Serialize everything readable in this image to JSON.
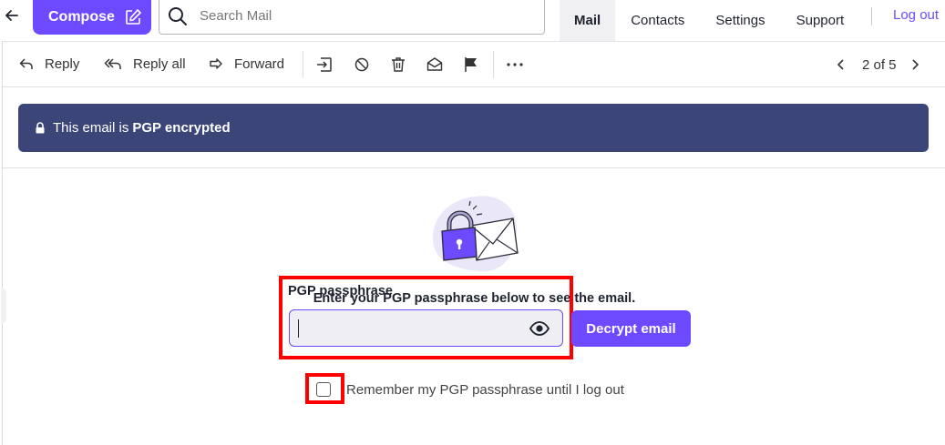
{
  "topbar": {
    "compose_label": "Compose",
    "search_placeholder": "Search Mail",
    "nav": [
      "Mail",
      "Contacts",
      "Settings",
      "Support"
    ],
    "active_nav": "Mail",
    "logout_label": "Log out"
  },
  "toolbar": {
    "reply_label": "Reply",
    "reply_all_label": "Reply all",
    "forward_label": "Forward",
    "icons": [
      "move-to-folder-icon",
      "spam-icon",
      "trash-icon",
      "mark-unread-icon",
      "flag-icon",
      "more-icon"
    ],
    "pager": "2 of 5"
  },
  "banner": {
    "prefix": "This email is",
    "emphasis": "PGP encrypted"
  },
  "decrypt": {
    "prompt": "Enter your PGP passphrase below to see the email.",
    "field_label": "PGP passphrase",
    "field_value": "",
    "button_label": "Decrypt email",
    "remember_label": "Remember my PGP passphrase until I log out",
    "remember_checked": false
  },
  "colors": {
    "accent": "#6d4aff",
    "banner": "#3c4577",
    "highlight": "#ff0000"
  }
}
